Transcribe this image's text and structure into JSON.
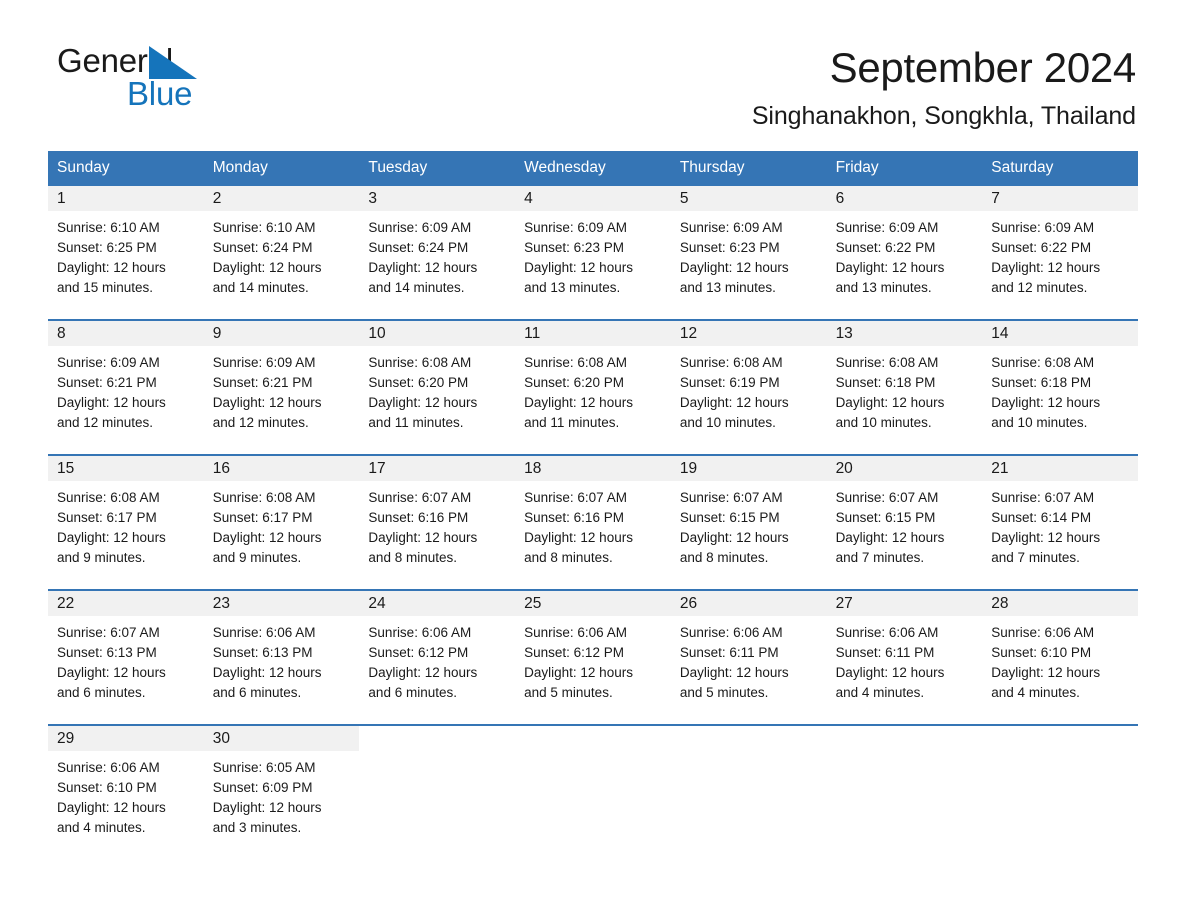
{
  "logo": {
    "word_one": "General",
    "word_two": "Blue",
    "triangle": "triangle-mark",
    "accent_color": "#1574bb"
  },
  "header": {
    "month_title": "September 2024",
    "location": "Singhanakhon, Songkhla, Thailand"
  },
  "theme": {
    "header_blue": "#3575b5",
    "daynum_band": "#f1f1f1",
    "text": "#1a1a1a"
  },
  "weekdays": [
    "Sunday",
    "Monday",
    "Tuesday",
    "Wednesday",
    "Thursday",
    "Friday",
    "Saturday"
  ],
  "weeks": [
    [
      {
        "day": "1",
        "sunrise": "Sunrise: 6:10 AM",
        "sunset": "Sunset: 6:25 PM",
        "daylight_line1": "Daylight: 12 hours",
        "daylight_line2": "and 15 minutes."
      },
      {
        "day": "2",
        "sunrise": "Sunrise: 6:10 AM",
        "sunset": "Sunset: 6:24 PM",
        "daylight_line1": "Daylight: 12 hours",
        "daylight_line2": "and 14 minutes."
      },
      {
        "day": "3",
        "sunrise": "Sunrise: 6:09 AM",
        "sunset": "Sunset: 6:24 PM",
        "daylight_line1": "Daylight: 12 hours",
        "daylight_line2": "and 14 minutes."
      },
      {
        "day": "4",
        "sunrise": "Sunrise: 6:09 AM",
        "sunset": "Sunset: 6:23 PM",
        "daylight_line1": "Daylight: 12 hours",
        "daylight_line2": "and 13 minutes."
      },
      {
        "day": "5",
        "sunrise": "Sunrise: 6:09 AM",
        "sunset": "Sunset: 6:23 PM",
        "daylight_line1": "Daylight: 12 hours",
        "daylight_line2": "and 13 minutes."
      },
      {
        "day": "6",
        "sunrise": "Sunrise: 6:09 AM",
        "sunset": "Sunset: 6:22 PM",
        "daylight_line1": "Daylight: 12 hours",
        "daylight_line2": "and 13 minutes."
      },
      {
        "day": "7",
        "sunrise": "Sunrise: 6:09 AM",
        "sunset": "Sunset: 6:22 PM",
        "daylight_line1": "Daylight: 12 hours",
        "daylight_line2": "and 12 minutes."
      }
    ],
    [
      {
        "day": "8",
        "sunrise": "Sunrise: 6:09 AM",
        "sunset": "Sunset: 6:21 PM",
        "daylight_line1": "Daylight: 12 hours",
        "daylight_line2": "and 12 minutes."
      },
      {
        "day": "9",
        "sunrise": "Sunrise: 6:09 AM",
        "sunset": "Sunset: 6:21 PM",
        "daylight_line1": "Daylight: 12 hours",
        "daylight_line2": "and 12 minutes."
      },
      {
        "day": "10",
        "sunrise": "Sunrise: 6:08 AM",
        "sunset": "Sunset: 6:20 PM",
        "daylight_line1": "Daylight: 12 hours",
        "daylight_line2": "and 11 minutes."
      },
      {
        "day": "11",
        "sunrise": "Sunrise: 6:08 AM",
        "sunset": "Sunset: 6:20 PM",
        "daylight_line1": "Daylight: 12 hours",
        "daylight_line2": "and 11 minutes."
      },
      {
        "day": "12",
        "sunrise": "Sunrise: 6:08 AM",
        "sunset": "Sunset: 6:19 PM",
        "daylight_line1": "Daylight: 12 hours",
        "daylight_line2": "and 10 minutes."
      },
      {
        "day": "13",
        "sunrise": "Sunrise: 6:08 AM",
        "sunset": "Sunset: 6:18 PM",
        "daylight_line1": "Daylight: 12 hours",
        "daylight_line2": "and 10 minutes."
      },
      {
        "day": "14",
        "sunrise": "Sunrise: 6:08 AM",
        "sunset": "Sunset: 6:18 PM",
        "daylight_line1": "Daylight: 12 hours",
        "daylight_line2": "and 10 minutes."
      }
    ],
    [
      {
        "day": "15",
        "sunrise": "Sunrise: 6:08 AM",
        "sunset": "Sunset: 6:17 PM",
        "daylight_line1": "Daylight: 12 hours",
        "daylight_line2": "and 9 minutes."
      },
      {
        "day": "16",
        "sunrise": "Sunrise: 6:08 AM",
        "sunset": "Sunset: 6:17 PM",
        "daylight_line1": "Daylight: 12 hours",
        "daylight_line2": "and 9 minutes."
      },
      {
        "day": "17",
        "sunrise": "Sunrise: 6:07 AM",
        "sunset": "Sunset: 6:16 PM",
        "daylight_line1": "Daylight: 12 hours",
        "daylight_line2": "and 8 minutes."
      },
      {
        "day": "18",
        "sunrise": "Sunrise: 6:07 AM",
        "sunset": "Sunset: 6:16 PM",
        "daylight_line1": "Daylight: 12 hours",
        "daylight_line2": "and 8 minutes."
      },
      {
        "day": "19",
        "sunrise": "Sunrise: 6:07 AM",
        "sunset": "Sunset: 6:15 PM",
        "daylight_line1": "Daylight: 12 hours",
        "daylight_line2": "and 8 minutes."
      },
      {
        "day": "20",
        "sunrise": "Sunrise: 6:07 AM",
        "sunset": "Sunset: 6:15 PM",
        "daylight_line1": "Daylight: 12 hours",
        "daylight_line2": "and 7 minutes."
      },
      {
        "day": "21",
        "sunrise": "Sunrise: 6:07 AM",
        "sunset": "Sunset: 6:14 PM",
        "daylight_line1": "Daylight: 12 hours",
        "daylight_line2": "and 7 minutes."
      }
    ],
    [
      {
        "day": "22",
        "sunrise": "Sunrise: 6:07 AM",
        "sunset": "Sunset: 6:13 PM",
        "daylight_line1": "Daylight: 12 hours",
        "daylight_line2": "and 6 minutes."
      },
      {
        "day": "23",
        "sunrise": "Sunrise: 6:06 AM",
        "sunset": "Sunset: 6:13 PM",
        "daylight_line1": "Daylight: 12 hours",
        "daylight_line2": "and 6 minutes."
      },
      {
        "day": "24",
        "sunrise": "Sunrise: 6:06 AM",
        "sunset": "Sunset: 6:12 PM",
        "daylight_line1": "Daylight: 12 hours",
        "daylight_line2": "and 6 minutes."
      },
      {
        "day": "25",
        "sunrise": "Sunrise: 6:06 AM",
        "sunset": "Sunset: 6:12 PM",
        "daylight_line1": "Daylight: 12 hours",
        "daylight_line2": "and 5 minutes."
      },
      {
        "day": "26",
        "sunrise": "Sunrise: 6:06 AM",
        "sunset": "Sunset: 6:11 PM",
        "daylight_line1": "Daylight: 12 hours",
        "daylight_line2": "and 5 minutes."
      },
      {
        "day": "27",
        "sunrise": "Sunrise: 6:06 AM",
        "sunset": "Sunset: 6:11 PM",
        "daylight_line1": "Daylight: 12 hours",
        "daylight_line2": "and 4 minutes."
      },
      {
        "day": "28",
        "sunrise": "Sunrise: 6:06 AM",
        "sunset": "Sunset: 6:10 PM",
        "daylight_line1": "Daylight: 12 hours",
        "daylight_line2": "and 4 minutes."
      }
    ],
    [
      {
        "day": "29",
        "sunrise": "Sunrise: 6:06 AM",
        "sunset": "Sunset: 6:10 PM",
        "daylight_line1": "Daylight: 12 hours",
        "daylight_line2": "and 4 minutes."
      },
      {
        "day": "30",
        "sunrise": "Sunrise: 6:05 AM",
        "sunset": "Sunset: 6:09 PM",
        "daylight_line1": "Daylight: 12 hours",
        "daylight_line2": "and 3 minutes."
      },
      {
        "day": "",
        "sunrise": "",
        "sunset": "",
        "daylight_line1": "",
        "daylight_line2": ""
      },
      {
        "day": "",
        "sunrise": "",
        "sunset": "",
        "daylight_line1": "",
        "daylight_line2": ""
      },
      {
        "day": "",
        "sunrise": "",
        "sunset": "",
        "daylight_line1": "",
        "daylight_line2": ""
      },
      {
        "day": "",
        "sunrise": "",
        "sunset": "",
        "daylight_line1": "",
        "daylight_line2": ""
      },
      {
        "day": "",
        "sunrise": "",
        "sunset": "",
        "daylight_line1": "",
        "daylight_line2": ""
      }
    ]
  ]
}
